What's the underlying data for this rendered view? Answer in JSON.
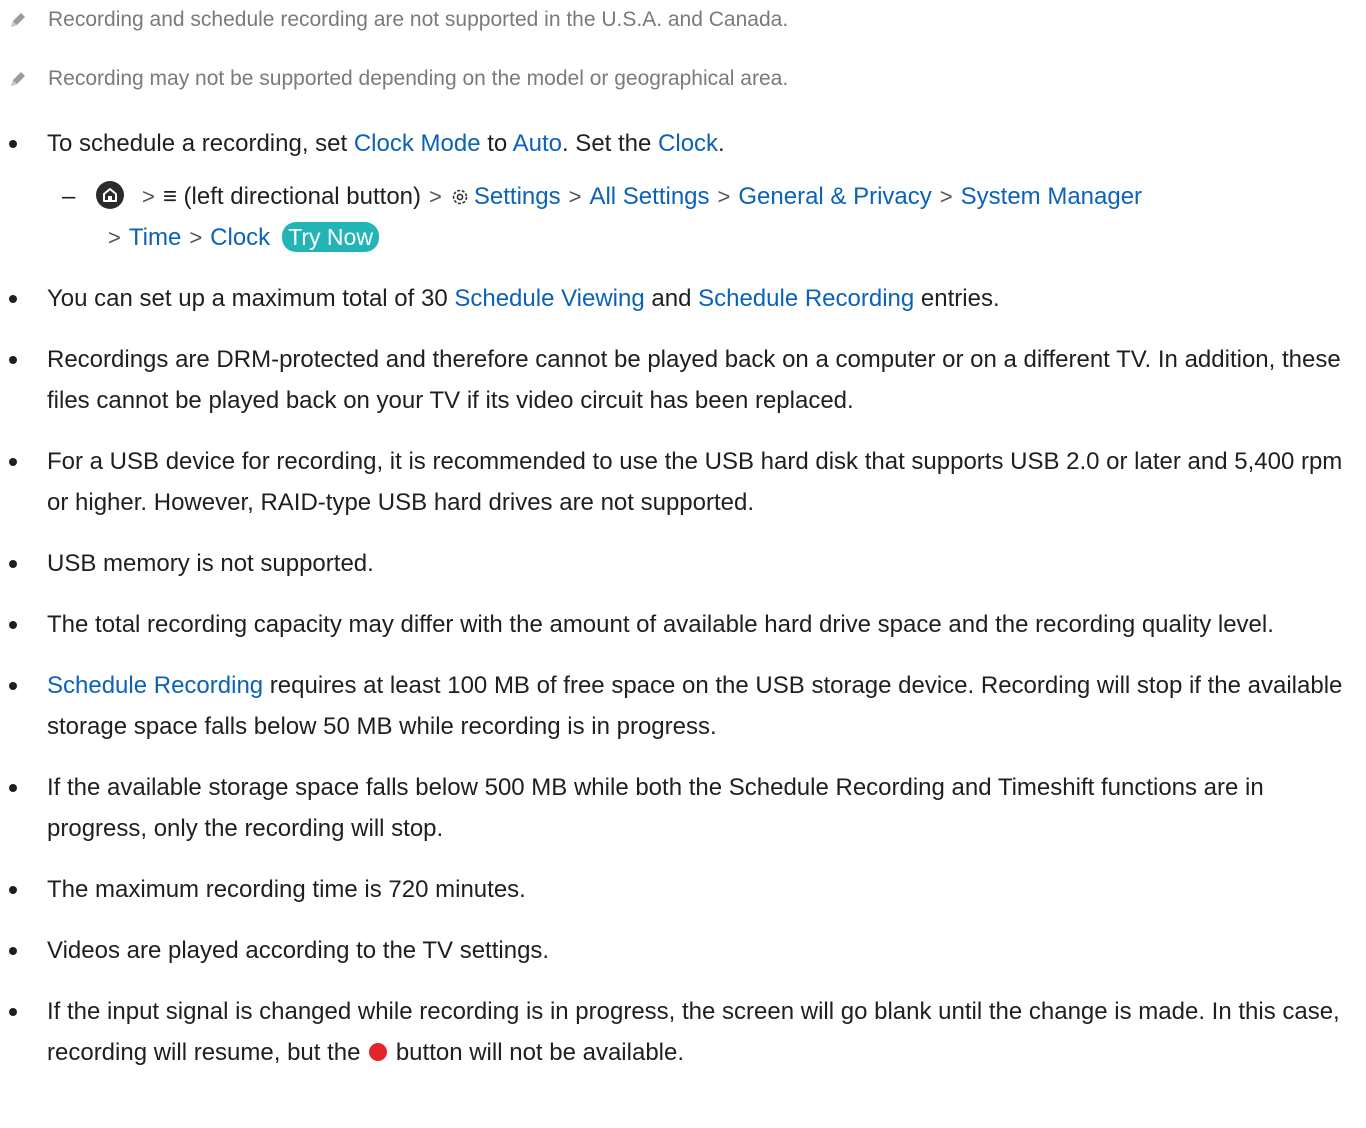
{
  "notes": [
    "Recording and schedule recording are not supported in the U.S.A. and Canada.",
    "Recording may not be supported depending on the model or geographical area."
  ],
  "b1": {
    "t1": "To schedule a recording, set ",
    "l1": "Clock Mode",
    "t2": " to ",
    "l2": "Auto",
    "t3": ". Set the ",
    "l3": "Clock",
    "t4": "."
  },
  "path": {
    "dash": "–",
    "menu_text": "(left directional button)",
    "settings": "Settings",
    "all_settings": "All Settings",
    "general": "General & Privacy",
    "system_manager": "System Manager",
    "time": "Time",
    "clock": "Clock",
    "try_now": "Try Now",
    "sep": ">"
  },
  "b2": {
    "t1": "You can set up a maximum total of 30 ",
    "l1": "Schedule Viewing",
    "t2": " and ",
    "l2": "Schedule Recording",
    "t3": " entries."
  },
  "b3": "Recordings are DRM-protected and therefore cannot be played back on a computer or on a different TV. In addition, these files cannot be played back on your TV if its video circuit has been replaced.",
  "b4": "For a USB device for recording, it is recommended to use the USB hard disk that supports USB 2.0 or later and 5,400 rpm or higher. However, RAID-type USB hard drives are not supported.",
  "b5": "USB memory is not supported.",
  "b6": "The total recording capacity may differ with the amount of available hard drive space and the recording quality level.",
  "b7": {
    "l1": "Schedule Recording",
    "t1": " requires at least 100 MB of free space on the USB storage device. Recording will stop if the available storage space falls below 50 MB while recording is in progress."
  },
  "b8": "If the available storage space falls below 500 MB while both the Schedule Recording and Timeshift functions are in progress, only the recording will stop.",
  "b9": "The maximum recording time is 720 minutes.",
  "b10": "Videos are played according to the TV settings.",
  "b11": {
    "t1": "If the input signal is changed while recording is in progress, the screen will go blank until the change is made. In this case, recording will resume, but the ",
    "t2": " button will not be available."
  },
  "colors": {
    "link": "#0b62b8",
    "try_now_bg": "#23b5b5",
    "record_dot": "#e3262b",
    "note_text": "#7a7a7a"
  },
  "icons": [
    "pencil-icon",
    "home-icon",
    "menu-icon",
    "gear-icon",
    "record-dot-icon"
  ]
}
